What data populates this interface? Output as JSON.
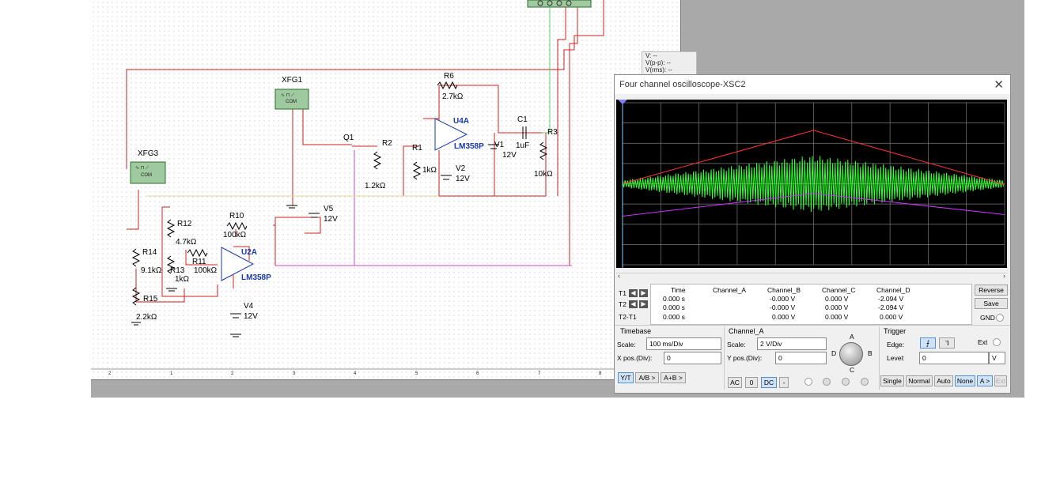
{
  "schematic": {
    "instruments": [
      "XFG1",
      "XFG3"
    ],
    "fg_terminals": [
      "COM"
    ],
    "labels": [
      {
        "id": "R6",
        "text": "R6"
      },
      {
        "id": "R6v",
        "text": "2.7kΩ"
      },
      {
        "id": "C1",
        "text": "C1"
      },
      {
        "id": "C1v",
        "text": "1uF"
      },
      {
        "id": "R3",
        "text": "R3"
      },
      {
        "id": "R3v",
        "text": "10kΩ"
      },
      {
        "id": "Q1",
        "text": "Q1"
      },
      {
        "id": "R2",
        "text": "R2"
      },
      {
        "id": "R2v",
        "text": "1.2kΩ"
      },
      {
        "id": "R1",
        "text": "R1"
      },
      {
        "id": "R1v",
        "text": "1kΩ"
      },
      {
        "id": "V1",
        "text": "V1"
      },
      {
        "id": "V1v",
        "text": "12V"
      },
      {
        "id": "V2",
        "text": "V2"
      },
      {
        "id": "V2v",
        "text": "12V"
      },
      {
        "id": "V5",
        "text": "V5"
      },
      {
        "id": "V5v",
        "text": "12V"
      },
      {
        "id": "R10",
        "text": "R10"
      },
      {
        "id": "R10v",
        "text": "100kΩ"
      },
      {
        "id": "R12",
        "text": "R12"
      },
      {
        "id": "R12v",
        "text": "4.7kΩ"
      },
      {
        "id": "R11",
        "text": "R11"
      },
      {
        "id": "R11v",
        "text": "100kΩ"
      },
      {
        "id": "R13",
        "text": "R13"
      },
      {
        "id": "R13v",
        "text": "1kΩ"
      },
      {
        "id": "R14",
        "text": "R14"
      },
      {
        "id": "R14v",
        "text": "9.1kΩ"
      },
      {
        "id": "R15",
        "text": "R15"
      },
      {
        "id": "R15v",
        "text": "2.2kΩ"
      },
      {
        "id": "V4",
        "text": "V4"
      },
      {
        "id": "V4v",
        "text": "12V"
      }
    ],
    "opamps": [
      {
        "name": "U4A",
        "model": "LM358P"
      },
      {
        "name": "U2A",
        "model": "LM358P"
      }
    ],
    "ruler_marks": [
      "2",
      "1",
      "2",
      "3",
      "4",
      "5",
      "6",
      "7",
      "8"
    ]
  },
  "mini_readout": {
    "v": "V: --",
    "vpp": "V(p-p): --",
    "vrms": "V(rms): --"
  },
  "oscilloscope": {
    "title": "Four channel oscilloscope-XSC2",
    "close_glyph": "✕",
    "trace_colors": {
      "channel_a": "#33ff33",
      "channel_b": "#ff3333",
      "channel_c": "#cc33ff",
      "cursor": "#7fd0ff"
    },
    "grid_divisions": {
      "horizontal": 10,
      "vertical": 8
    },
    "measurements": {
      "headers": [
        "Time",
        "Channel_A",
        "Channel_B",
        "Channel_C",
        "Channel_D"
      ],
      "rows": [
        {
          "label": "T1",
          "time": "0.000 s",
          "a": "",
          "b": "-0.000 V",
          "c": "0.000 V",
          "d": "-2.094 V"
        },
        {
          "label": "T2",
          "time": "0.000 s",
          "a": "",
          "b": "-0.000 V",
          "c": "0.000 V",
          "d": "-2.094 V"
        },
        {
          "label": "T2-T1",
          "time": "0.000 s",
          "a": "",
          "b": "0.000 V",
          "c": "0.000 V",
          "d": "0.000 V"
        }
      ]
    },
    "buttons": {
      "reverse": "Reverse",
      "save": "Save",
      "gnd": "GND"
    },
    "timebase": {
      "title": "Timebase",
      "scale_label": "Scale:",
      "scale_value": "100 ms/Div",
      "xpos_label": "X pos.(Div):",
      "xpos_value": "0",
      "modes": [
        "Y/T",
        "A/B >",
        "A+B >"
      ]
    },
    "channel": {
      "title": "Channel_A",
      "scale_label": "Scale:",
      "scale_value": "2  V/Div",
      "ypos_label": "Y pos.(Div):",
      "ypos_value": "0",
      "coupling": [
        "AC",
        "0",
        "DC",
        "-"
      ],
      "knob_labels": [
        "A",
        "B",
        "C",
        "D"
      ]
    },
    "trigger": {
      "title": "Trigger",
      "edge_label": "Edge:",
      "ext_label": "Ext",
      "level_label": "Level:",
      "level_value": "0",
      "level_unit": "V",
      "modes": [
        "Single",
        "Normal",
        "Auto",
        "None",
        "A >",
        "Ext"
      ]
    }
  }
}
